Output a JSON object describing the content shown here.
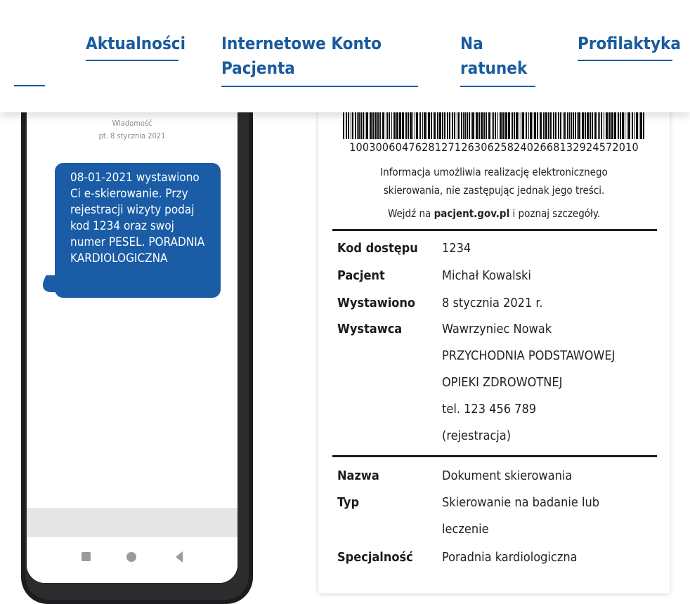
{
  "nav": {
    "items": [
      {
        "label": "Aktualności"
      },
      {
        "label_line1": "Internetowe Konto",
        "label_line2": "Pacjenta"
      },
      {
        "label_line1": "Na",
        "label_line2": "ratunek"
      },
      {
        "label": "Profilaktyka"
      }
    ],
    "color": "#1a5b9e"
  },
  "phone": {
    "header_title": "Wiadomość",
    "header_date": "pt. 8 stycznia 2021",
    "message_lines": [
      "08-01-2021 wystawiono",
      "Ci e-skierowanie. Przy",
      "rejestracji wizyty podaj",
      "kod 1234 oraz swoj",
      "numer PESEL. PORADNIA",
      "KARDIOLOGICZNA"
    ],
    "bubble_color": "#1a5ca6",
    "nav_icons": [
      "square-icon",
      "circle-icon",
      "back-icon"
    ]
  },
  "document": {
    "barcode_number": "10030060476281271263062582402668132924572010",
    "info_line1": "Informacja umożliwia realizację elektronicznego",
    "info_line2": "skierowania, nie zastępując jednak jego treści.",
    "info_line3_prefix": "Wejdź na ",
    "info_line3_link": "pacjent.gov.pl",
    "info_line3_suffix": " i poznaj szczegóły.",
    "fields": {
      "kod_dostepu_label": "Kod dostępu",
      "kod_dostepu_value": "1234",
      "pacjent_label": "Pacjent",
      "pacjent_value": "Michał Kowalski",
      "wystawiono_label": "Wystawiono",
      "wystawiono_value": "8 stycznia 2021 r.",
      "wystawca_label": "Wystawca",
      "wystawca_lines": [
        "Wawrzyniec Nowak",
        "PRZYCHODNIA PODSTAWOWEJ",
        "OPIEKI ZDROWOTNEJ",
        "tel. 123 456 789",
        "(rejestracja)"
      ],
      "nazwa_label": "Nazwa",
      "nazwa_value": "Dokument skierowania",
      "typ_label": "Typ",
      "typ_lines": [
        "Skierowanie na badanie lub",
        "leczenie"
      ],
      "specjalnosc_label": "Specjalność",
      "specjalnosc_value": "Poradnia kardiologiczna"
    }
  }
}
